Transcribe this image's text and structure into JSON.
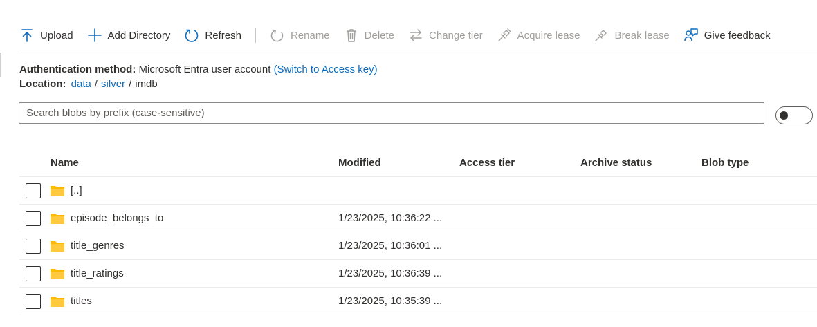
{
  "toolbar": {
    "upload": "Upload",
    "add_directory": "Add Directory",
    "refresh": "Refresh",
    "rename": "Rename",
    "delete": "Delete",
    "change_tier": "Change tier",
    "acquire_lease": "Acquire lease",
    "break_lease": "Break lease",
    "give_feedback": "Give feedback"
  },
  "info": {
    "auth_label": "Authentication method:",
    "auth_value": "Microsoft Entra user account",
    "switch_link": "(Switch to Access key)",
    "location_label": "Location:",
    "path": [
      "data",
      "silver",
      "imdb"
    ],
    "separator": "/"
  },
  "search": {
    "placeholder": "Search blobs by prefix (case-sensitive)"
  },
  "table": {
    "headers": [
      "Name",
      "Modified",
      "Access tier",
      "Archive status",
      "Blob type"
    ],
    "rows": [
      {
        "name": "[..]",
        "modified": ""
      },
      {
        "name": "episode_belongs_to",
        "modified": "1/23/2025, 10:36:22 ..."
      },
      {
        "name": "title_genres",
        "modified": "1/23/2025, 10:36:01 ..."
      },
      {
        "name": "title_ratings",
        "modified": "1/23/2025, 10:36:39 ..."
      },
      {
        "name": "titles",
        "modified": "1/23/2025, 10:35:39 ..."
      }
    ]
  },
  "colors": {
    "accent": "#0f6cbd",
    "folder": "#ffb900",
    "text": "#323130",
    "disabled": "#a19f9d"
  },
  "icons": [
    "upload-icon",
    "plus-icon",
    "refresh-icon",
    "rename-icon",
    "trash-icon",
    "change-tier-icon",
    "acquire-lease-icon",
    "break-lease-icon",
    "feedback-icon",
    "folder-icon"
  ]
}
